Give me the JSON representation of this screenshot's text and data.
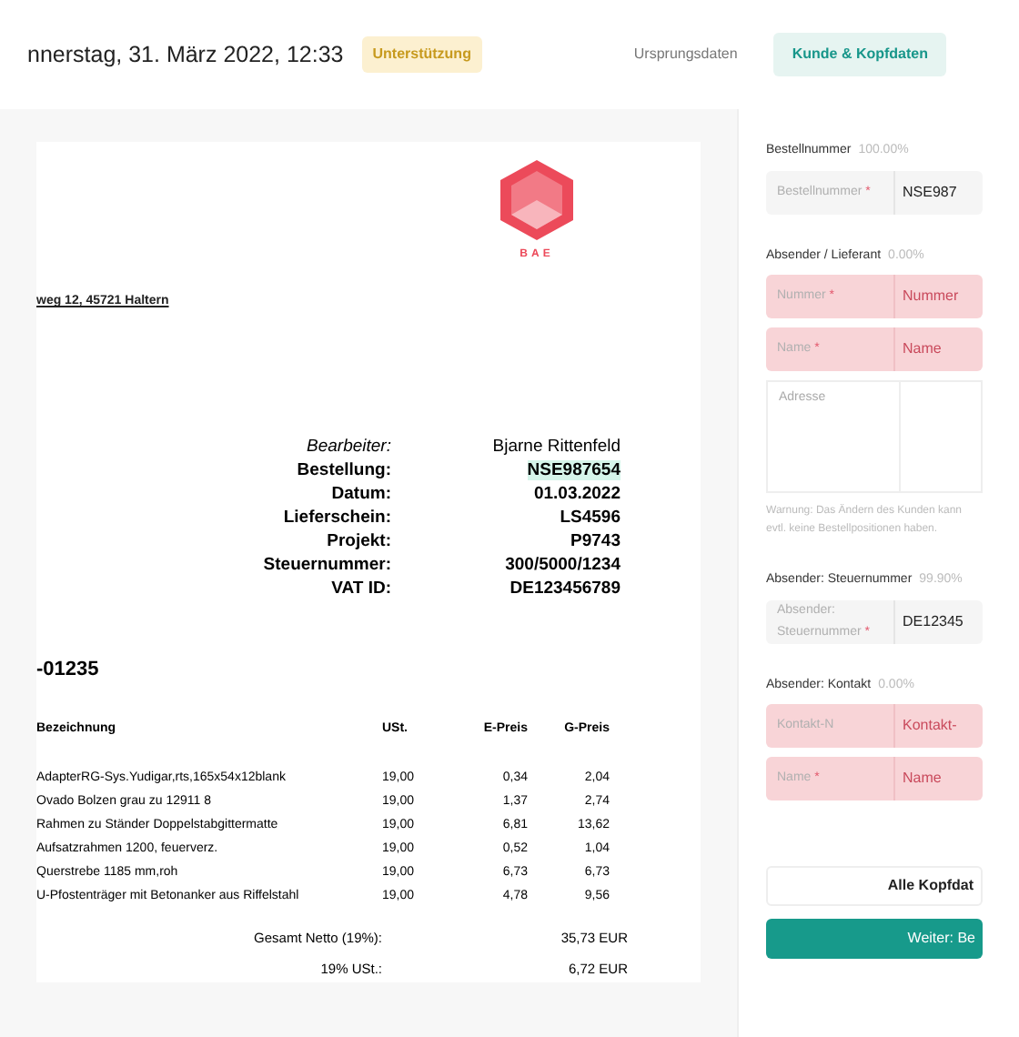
{
  "header": {
    "datetime": "nnerstag, 31. März 2022, 12:33",
    "badge": "Unterstützung",
    "tabs": [
      {
        "label": "Ursprungsdaten",
        "selected": false
      },
      {
        "label": "Kunde & Kopfdaten",
        "selected": true
      }
    ]
  },
  "document": {
    "logo_text": "BAE",
    "address": "weg 12, 45721 Haltern",
    "info": [
      {
        "label": "Bearbeiter:",
        "value": "Bjarne Rittenfeld",
        "italic": true,
        "highlighted": false
      },
      {
        "label": "Bestellung:",
        "value": "NSE987654",
        "italic": false,
        "highlighted": true
      },
      {
        "label": "Datum:",
        "value": "01.03.2022",
        "italic": false,
        "highlighted": false
      },
      {
        "label": "Lieferschein:",
        "value": "LS4596",
        "italic": false,
        "highlighted": false
      },
      {
        "label": "Projekt:",
        "value": "P9743",
        "italic": false,
        "highlighted": false
      },
      {
        "label": "Steuernummer:",
        "value": "300/5000/1234",
        "italic": false,
        "highlighted": false
      },
      {
        "label": "VAT ID:",
        "value": "DE123456789",
        "italic": false,
        "highlighted": false
      }
    ],
    "number": "-01235",
    "table": {
      "columns": [
        "Bezeichnung",
        "USt.",
        "E-Preis",
        "G-Preis"
      ],
      "rows": [
        [
          "AdapterRG-Sys.Yudigar,rts,165x54x12blank",
          "19,00",
          "0,34",
          "2,04"
        ],
        [
          "Ovado Bolzen grau zu 12911 8",
          "19,00",
          "1,37",
          "2,74"
        ],
        [
          "Rahmen zu Ständer Doppelstabgittermatte",
          "19,00",
          "6,81",
          "13,62"
        ],
        [
          "Aufsatzrahmen 1200, feuerverz.",
          "19,00",
          "0,52",
          "1,04"
        ],
        [
          "Querstrebe 1185 mm,roh",
          "19,00",
          "6,73",
          "6,73"
        ],
        [
          "U-Pfostenträger mit Betonanker aus Riffelstahl",
          "19,00",
          "4,78",
          "9,56"
        ]
      ]
    },
    "totals": [
      {
        "label": "Gesamt Netto (19%):",
        "value": "35,73 EUR"
      },
      {
        "label": "19% USt.:",
        "value": "6,72 EUR"
      }
    ]
  },
  "form": {
    "sections": [
      {
        "title": "Bestellnummer",
        "percent": "100.00%",
        "fields": [
          {
            "kind": "field",
            "label": "Bestellnummer",
            "required_mark": "*",
            "invalid": false,
            "value": "NSE987"
          }
        ]
      },
      {
        "title": "Absender / Lieferant",
        "percent": "0.00%",
        "fields": [
          {
            "kind": "field",
            "label": "Nummer",
            "required_mark": "*",
            "invalid": true,
            "placeholder": "Nummer"
          },
          {
            "kind": "field",
            "label": "Name",
            "required_mark": "*",
            "invalid": true,
            "placeholder": "Name"
          },
          {
            "kind": "textarea",
            "label": "Adresse"
          }
        ],
        "note": "Warnung: Das Ändern des Kunden kann evtl. keine Bestellpositionen haben."
      },
      {
        "title": "Absender: Steuernummer",
        "percent": "99.90%",
        "fields": [
          {
            "kind": "field",
            "label": "Absender: Steuernummer",
            "required_mark": "*",
            "invalid": false,
            "value": "DE12345"
          }
        ]
      },
      {
        "title": "Absender: Kontakt",
        "percent": "0.00%",
        "fields": [
          {
            "kind": "field",
            "label": "Kontakt-N",
            "invalid": true,
            "placeholder": "Kontakt-"
          },
          {
            "kind": "field",
            "label": "Name",
            "required_mark": "*",
            "invalid": true,
            "placeholder": "Name"
          }
        ]
      }
    ],
    "buttons": [
      {
        "kind": "secondary",
        "label": "Alle Kopfdat"
      },
      {
        "kind": "primary",
        "label": "Weiter: Be"
      }
    ]
  }
}
